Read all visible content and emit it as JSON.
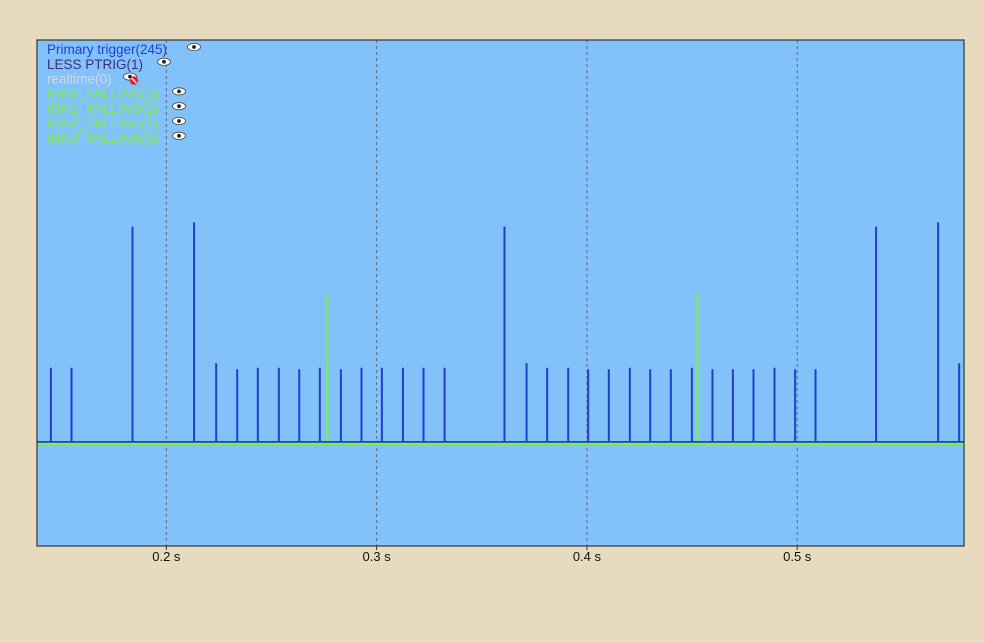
{
  "colors": {
    "page_background": "#e8dabe",
    "plot_background": "#83c1fa",
    "plot_border": "#333333",
    "grid": "#5a6e85",
    "primary": "#1f3fcf",
    "ignition": "#7cf03c",
    "eye_icon": "#ffffff",
    "hidden_badge": "#e0262a"
  },
  "chart_data": {
    "type": "line",
    "chart_kind": "logic-analyzer event trace",
    "title": "",
    "xlabel": "",
    "ylabel": "",
    "xlim": [
      0.1385,
      0.5793
    ],
    "x_unit": "s",
    "x_ticks": [
      0.2,
      0.3,
      0.4,
      0.5
    ],
    "x_tick_labels": [
      "0.2 s",
      "0.3 s",
      "0.4 s",
      "0.5 s"
    ],
    "grid": true,
    "grid_style": "dashed vertical lines at x ticks",
    "legend_position": "top-left",
    "ylim": [
      -1,
      2
    ],
    "baseline": 0,
    "legend": [
      {
        "label": "Primary trigger(245)",
        "color": "#1f3fcf",
        "visible": true,
        "icon": "eye-icon"
      },
      {
        "label": "LESS PTRIG(1)",
        "color": "#3b2f7a",
        "visible": true,
        "icon": "eye-icon"
      },
      {
        "label": "realtime(0)",
        "color": "#d0d8e4",
        "visible": false,
        "icon": "eye-hidden-icon"
      },
      {
        "label": "IGN0_FALLING(3)",
        "color": "#7cf03c",
        "visible": true,
        "icon": "eye-icon"
      },
      {
        "label": "IGN1_FALLING(2)",
        "color": "#7cf03c",
        "visible": true,
        "icon": "eye-icon"
      },
      {
        "label": "IGN2_FALLING(4)",
        "color": "#7cf03c",
        "visible": true,
        "icon": "eye-icon"
      },
      {
        "label": "IGN3_FALLING(3)",
        "color": "#7cf03c",
        "visible": true,
        "icon": "eye-icon"
      }
    ],
    "series": [
      {
        "name": "Primary trigger(245)",
        "kind": "pulses",
        "color": "#1f3fcf",
        "points": [
          {
            "x": 0.1451,
            "y": 0.5
          },
          {
            "x": 0.1549,
            "y": 0.5
          },
          {
            "x": 0.1839,
            "y": 1.45
          },
          {
            "x": 0.2132,
            "y": 1.48
          },
          {
            "x": 0.2237,
            "y": 0.53
          },
          {
            "x": 0.2337,
            "y": 0.49
          },
          {
            "x": 0.2435,
            "y": 0.5
          },
          {
            "x": 0.2535,
            "y": 0.5
          },
          {
            "x": 0.2632,
            "y": 0.49
          },
          {
            "x": 0.273,
            "y": 0.5
          },
          {
            "x": 0.283,
            "y": 0.49
          },
          {
            "x": 0.2928,
            "y": 0.5
          },
          {
            "x": 0.3025,
            "y": 0.5
          },
          {
            "x": 0.3125,
            "y": 0.5
          },
          {
            "x": 0.3223,
            "y": 0.5
          },
          {
            "x": 0.3323,
            "y": 0.5
          },
          {
            "x": 0.3608,
            "y": 1.45
          },
          {
            "x": 0.3713,
            "y": 0.53
          },
          {
            "x": 0.3811,
            "y": 0.5
          },
          {
            "x": 0.3911,
            "y": 0.5
          },
          {
            "x": 0.4006,
            "y": 0.49
          },
          {
            "x": 0.4104,
            "y": 0.49
          },
          {
            "x": 0.4204,
            "y": 0.5
          },
          {
            "x": 0.4301,
            "y": 0.49
          },
          {
            "x": 0.4399,
            "y": 0.49
          },
          {
            "x": 0.4499,
            "y": 0.5
          },
          {
            "x": 0.4597,
            "y": 0.49
          },
          {
            "x": 0.4694,
            "y": 0.49
          },
          {
            "x": 0.4792,
            "y": 0.49
          },
          {
            "x": 0.4892,
            "y": 0.5
          },
          {
            "x": 0.499,
            "y": 0.49
          },
          {
            "x": 0.5087,
            "y": 0.49
          },
          {
            "x": 0.5375,
            "y": 1.45
          },
          {
            "x": 0.567,
            "y": 1.48
          },
          {
            "x": 0.577,
            "y": 0.53
          }
        ]
      },
      {
        "name": "IGN0_FALLING(3)",
        "kind": "pulses",
        "color": "#7cf03c",
        "points": [
          {
            "x": 0.2766,
            "y": 1.0
          },
          {
            "x": 0.4525,
            "y": 1.0
          }
        ]
      }
    ]
  }
}
